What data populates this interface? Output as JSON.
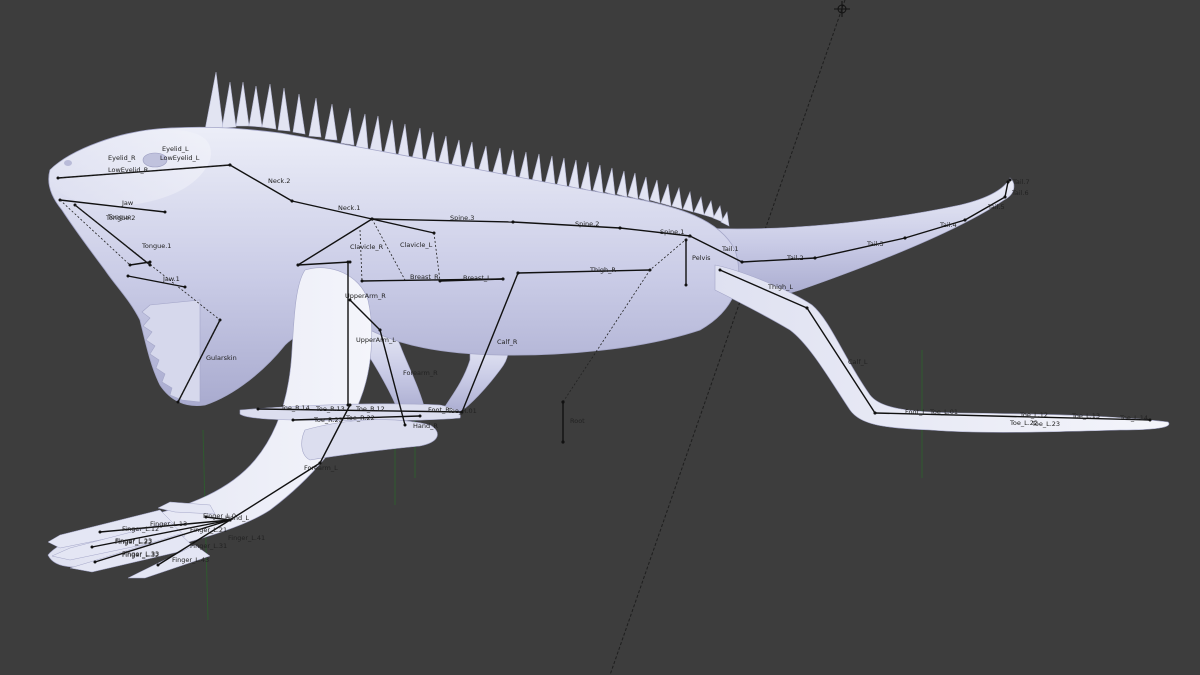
{
  "viewport": {
    "background": "#3d3d3d",
    "mesh_color": "#d4d6ec",
    "bone_color": "#111111",
    "grid_axis_color": "#2f5a2f"
  },
  "empty_object": {
    "icon": "empty-crosshair-icon"
  },
  "bones": {
    "head": {
      "eyelid_l": "Eyelid_L",
      "eyelid_r": "Eyelid_R",
      "lower_eyelid_l": "LowEyelid_L",
      "lower_eyelid_r": "LowEyelid_R",
      "jaw": "Jaw",
      "tongue": "Tongue",
      "tongue_1": "Tongue.1",
      "tongue_2": "Tongue.2",
      "jaw_1": "Jaw.1",
      "gularskin": "Gularskin"
    },
    "spine": {
      "neck_2": "Neck.2",
      "neck_1": "Neck.1",
      "spine_3": "Spine.3",
      "spine_2": "Spine.2",
      "spine_1": "Spine.1",
      "pelvis": "Pelvis",
      "root": "Root"
    },
    "tail": {
      "tail_1": "Tail.1",
      "tail_2": "Tail.2",
      "tail_3": "Tail.3",
      "tail_4": "Tail.4",
      "tail_5": "Tail.5",
      "tail_6": "Tail.6",
      "tail_7": "Tail.7"
    },
    "front_right": {
      "clavicle_r": "Clavicle_R",
      "upperarm_r": "UpperArm_R",
      "forearm_r": "Forearm_R",
      "hand_r": "Hand_R",
      "breast_r": "Breast_R"
    },
    "front_left": {
      "clavicle_l": "Clavicle_L",
      "upperarm_l": "UpperArm_L",
      "forearm_l": "Forearm_L",
      "hand_l": "Hand_L",
      "breast_l": "Breast_L",
      "finger_l_0": "Finger_L.0",
      "finger_l_12": "Finger_L.12",
      "finger_l_13": "Finger_L.13",
      "finger_l_22": "Finger_L.22",
      "finger_l_23": "Finger_L.23",
      "finger_l_32": "Finger_L.32",
      "finger_l_33": "Finger_L.33",
      "finger_l_43": "Finger_L.43",
      "finger_l_21": "Finger_L.21",
      "finger_l_31": "Finger_L.31",
      "finger_l_41": "Finger_L.41"
    },
    "hind_right": {
      "thigh_r": "Thigh_R",
      "calf_r": "Calf_R",
      "foot_r": "Foot_R",
      "toe_r_14": "Toe_R.14",
      "toe_r_13": "Toe_R.13",
      "toe_r_12": "Toe_R.12",
      "toe_r_23": "Toe_R.23",
      "toe_r_22": "Toe_R.22",
      "toe_r_01": "Toe_R.01"
    },
    "hind_left": {
      "thigh_l": "Thigh_L",
      "calf_l": "Calf_L",
      "foot_l": "Foot_L",
      "toe_l_12": "Toe_L.12",
      "toe_l_13": "Toe_L.13",
      "toe_l_14": "Toe_L.14",
      "toe_l_22": "Toe_L.22",
      "toe_l_23": "Toe_L.23",
      "toe_l_01": "Toe_L.01"
    }
  }
}
